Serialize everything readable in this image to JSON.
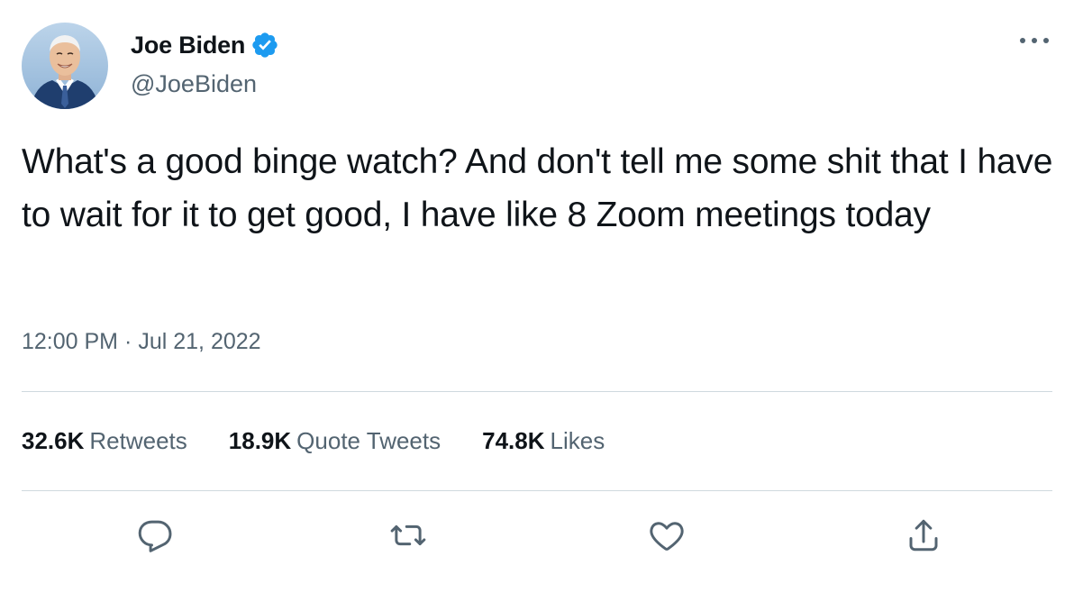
{
  "author": {
    "display_name": "Joe Biden",
    "handle": "@JoeBiden",
    "verified": true,
    "avatar_icon": "user-avatar-photo"
  },
  "tweet": {
    "text": "What's a good binge watch? And don't tell me some shit that I have to wait for it to get good, I have like 8 Zoom meetings today",
    "time": "12:00 PM",
    "separator": "·",
    "date": "Jul 21, 2022"
  },
  "stats": {
    "retweets": {
      "count": "32.6K",
      "label": "Retweets"
    },
    "quote_tweets": {
      "count": "18.9K",
      "label": "Quote Tweets"
    },
    "likes": {
      "count": "74.8K",
      "label": "Likes"
    }
  },
  "actions": [
    {
      "name": "reply",
      "icon": "reply-icon"
    },
    {
      "name": "retweet",
      "icon": "retweet-icon"
    },
    {
      "name": "like",
      "icon": "heart-icon"
    },
    {
      "name": "share",
      "icon": "share-icon"
    }
  ],
  "colors": {
    "text_primary": "#0f1419",
    "text_secondary": "#536471",
    "verified_blue": "#1d9bf0",
    "divider": "#cfd9de"
  }
}
